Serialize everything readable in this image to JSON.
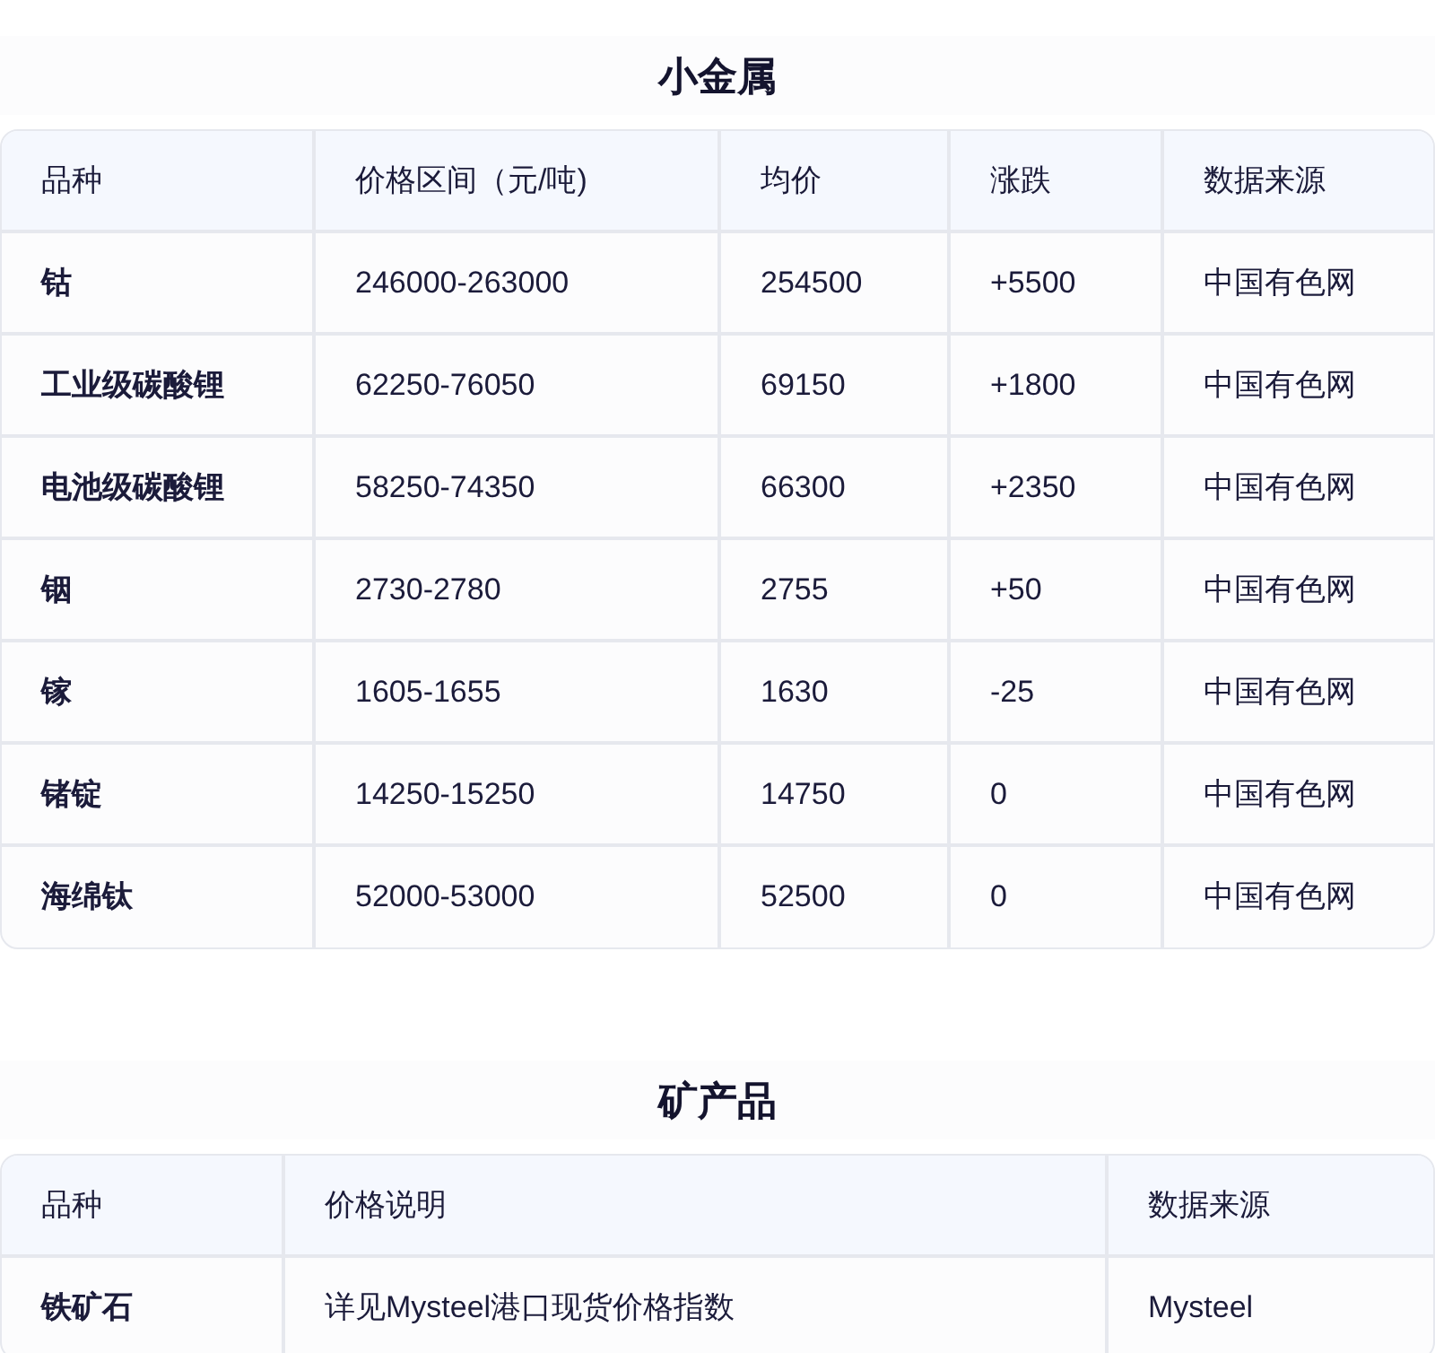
{
  "sections": [
    {
      "title": "小金属",
      "table": {
        "columns": [
          "品种",
          "价格区间（元/吨)",
          "均价",
          "涨跌",
          "数据来源"
        ],
        "rows": [
          [
            "钴",
            "246000-263000",
            "254500",
            "+5500",
            "中国有色网"
          ],
          [
            "工业级碳酸锂",
            "62250-76050",
            "69150",
            "+1800",
            "中国有色网"
          ],
          [
            "电池级碳酸锂",
            "58250-74350",
            "66300",
            "+2350",
            "中国有色网"
          ],
          [
            "铟",
            "2730-2780",
            "2755",
            "+50",
            "中国有色网"
          ],
          [
            "镓",
            "1605-1655",
            "1630",
            "-25",
            "中国有色网"
          ],
          [
            "锗锭",
            "14250-15250",
            "14750",
            "0",
            "中国有色网"
          ],
          [
            "海绵钛",
            "52000-53000",
            "52500",
            "0",
            "中国有色网"
          ]
        ]
      }
    },
    {
      "title": "矿产品",
      "table": {
        "columns": [
          "品种",
          "价格说明",
          "数据来源"
        ],
        "rows": [
          [
            "铁矿石",
            "详见Mysteel港口现货价格指数",
            "Mysteel"
          ]
        ]
      }
    }
  ]
}
